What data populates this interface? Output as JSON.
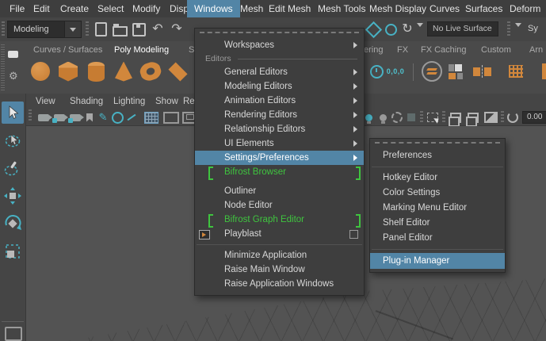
{
  "menubar": {
    "items": [
      "File",
      "Edit",
      "Create",
      "Select",
      "Modify",
      "Display",
      "Windows",
      "Mesh",
      "Edit Mesh",
      "Mesh Tools",
      "Mesh Display",
      "Curves",
      "Surfaces",
      "Deform"
    ],
    "active_item": "Windows"
  },
  "status_line": {
    "mode": "Modeling",
    "live_surface": "No Live Surface",
    "symmetry_fragment": "Sy",
    "icons_left": [
      "new-scene",
      "open-scene",
      "save-scene",
      "undo",
      "redo"
    ],
    "icons_right": [
      "snap-together",
      "make-live",
      "construction-history"
    ]
  },
  "shelf": {
    "tabs_left": [
      "Curves / Surfaces",
      "Poly Modeling",
      "Sc"
    ],
    "active_tab": "Poly Modeling",
    "tabs_right": [
      "ering",
      "FX",
      "FX Caching",
      "Custom",
      "Arn"
    ],
    "coordinate_badge": "0,0,0",
    "icons_left": [
      "poly-sphere",
      "poly-cube",
      "poly-cylinder",
      "poly-cone",
      "poly-torus",
      "poly-plane"
    ],
    "icons_right": [
      "history-clock",
      "origin-coordinates",
      "smooth-layers",
      "layout-squares",
      "mirror-geometry",
      "lattice-grid"
    ]
  },
  "toolbox": {
    "tools": [
      "select",
      "lasso-select",
      "paint-select",
      "move",
      "rotate",
      "scale"
    ],
    "active_tool": "select"
  },
  "panel": {
    "menus": [
      "View",
      "Shading",
      "Lighting",
      "Show",
      "Ren"
    ],
    "exposure": "0.00"
  },
  "windows_menu": {
    "title": "Windows",
    "section_label": "Editors",
    "items": [
      {
        "label": "Workspaces",
        "submenu": true
      },
      {
        "label": "General Editors",
        "submenu": true
      },
      {
        "label": "Modeling Editors",
        "submenu": true
      },
      {
        "label": "Animation Editors",
        "submenu": true
      },
      {
        "label": "Rendering Editors",
        "submenu": true
      },
      {
        "label": "Relationship Editors",
        "submenu": true
      },
      {
        "label": "UI Elements",
        "submenu": true
      },
      {
        "label": "Settings/Preferences",
        "submenu": true,
        "highlighted": true
      },
      {
        "label": "Bifrost Browser",
        "new_feature": true
      },
      {
        "label": "Outliner"
      },
      {
        "label": "Node Editor"
      },
      {
        "label": "Bifrost Graph Editor",
        "new_feature": true
      },
      {
        "label": "Playblast",
        "has_option_box": true
      },
      {
        "label": "Minimize Application"
      },
      {
        "label": "Raise Main Window"
      },
      {
        "label": "Raise Application Windows"
      }
    ]
  },
  "settings_submenu": {
    "items": [
      {
        "label": "Preferences"
      },
      {
        "label": "Hotkey Editor"
      },
      {
        "label": "Color Settings"
      },
      {
        "label": "Marking Menu Editor"
      },
      {
        "label": "Shelf Editor"
      },
      {
        "label": "Panel Editor"
      },
      {
        "label": "Plug-in Manager",
        "highlighted": true
      }
    ]
  },
  "colors": {
    "selection_blue": "#5285a6",
    "new_feature_green": "#3fc43f",
    "shelf_orange": "#d1873c",
    "accent_teal": "#48b2c4",
    "viewport_gray": "#535353"
  }
}
